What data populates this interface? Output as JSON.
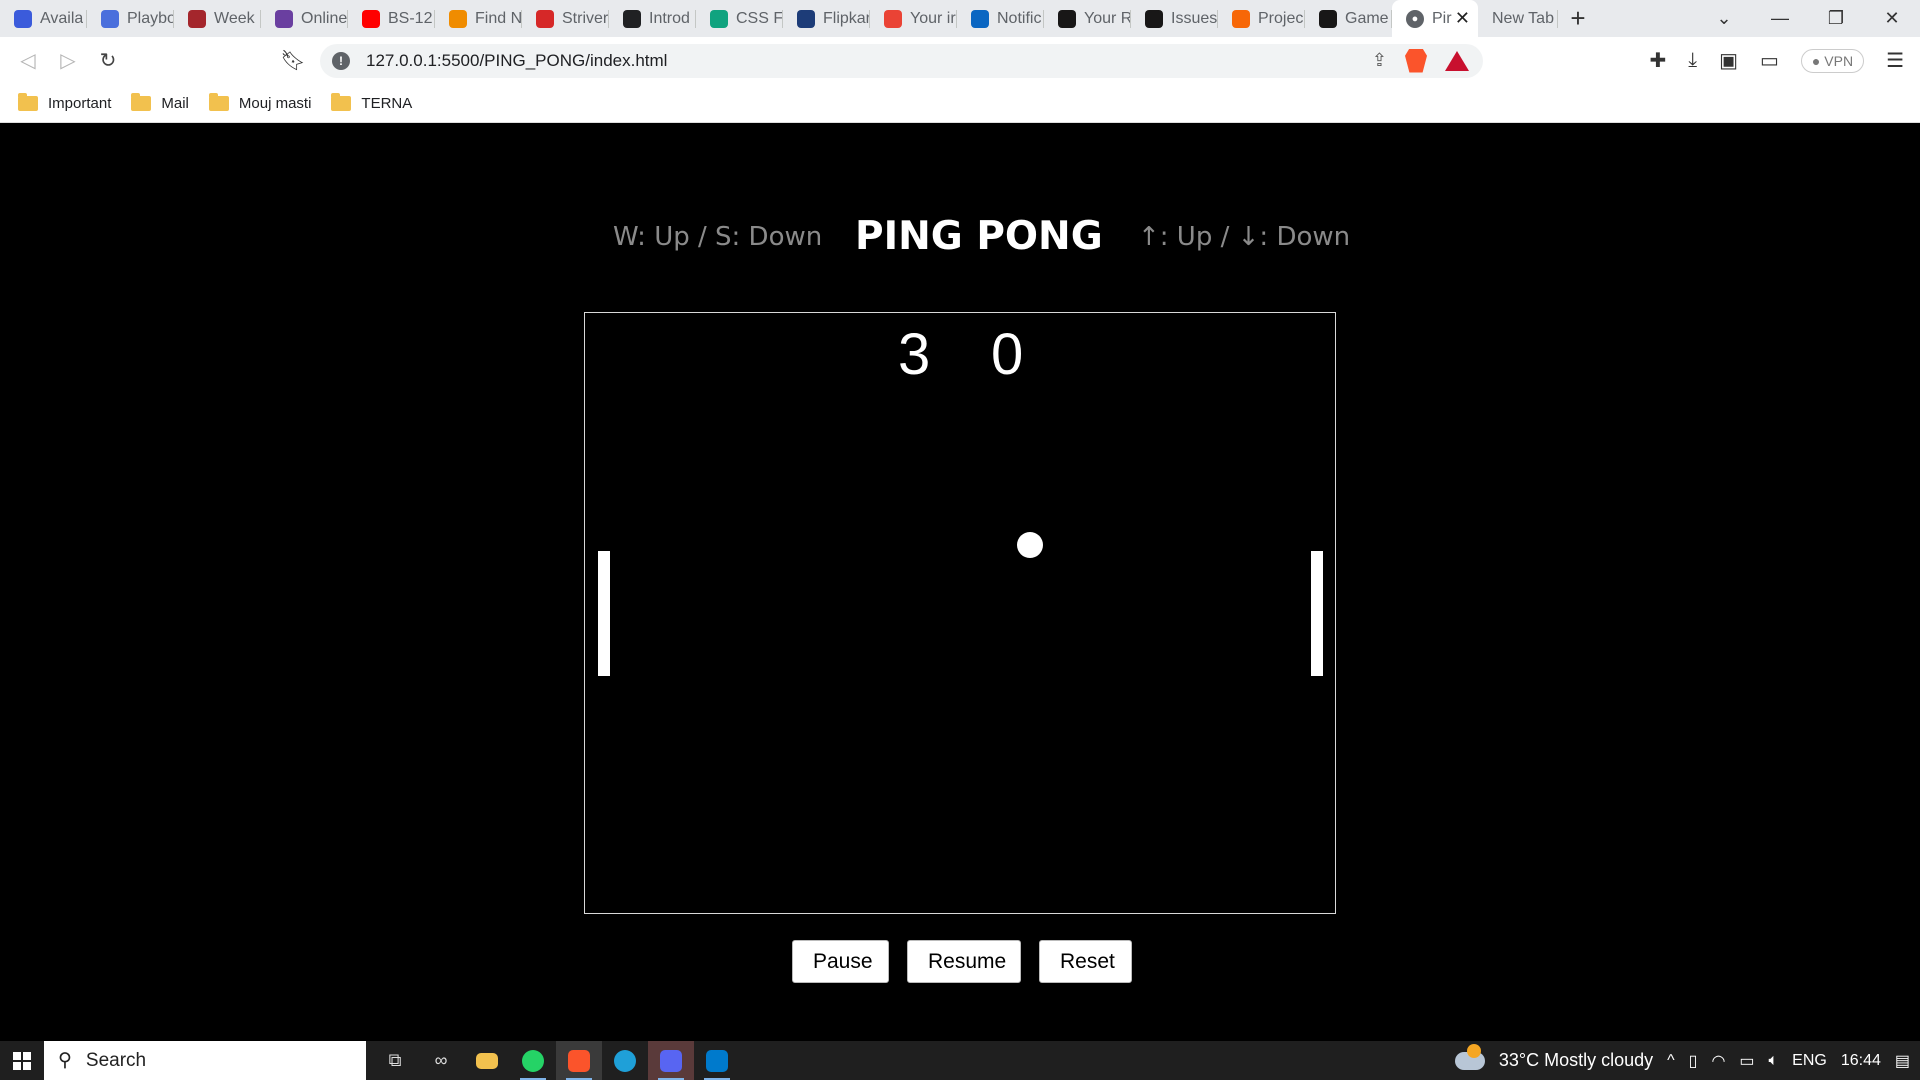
{
  "browser": {
    "tabs": [
      {
        "title": "Availa",
        "icon": "u-icon",
        "color": "#3b5bdb"
      },
      {
        "title": "Playbo",
        "icon": "ux-icon",
        "color": "#4a6fdc"
      },
      {
        "title": "Week",
        "icon": "shield-icon",
        "color": "#a4262c"
      },
      {
        "title": "Online",
        "icon": "bolt-icon",
        "color": "#6a3fa0"
      },
      {
        "title": "BS-12",
        "icon": "youtube-icon",
        "color": "#ff0000"
      },
      {
        "title": "Find N",
        "icon": "code-icon",
        "color": "#f08c00"
      },
      {
        "title": "Striver",
        "icon": "tuf-icon",
        "color": "#d62828"
      },
      {
        "title": "Introd",
        "icon": "openai-icon",
        "color": "#202123"
      },
      {
        "title": "CSS Fo",
        "icon": "openai-icon",
        "color": "#10a37f"
      },
      {
        "title": "Flipkar",
        "icon": "un-icon",
        "color": "#1d3c78"
      },
      {
        "title": "Your ir",
        "icon": "gmail-icon",
        "color": "#ea4335"
      },
      {
        "title": "Notific",
        "icon": "linkedin-icon",
        "color": "#0a66c2"
      },
      {
        "title": "Your R",
        "icon": "github-icon",
        "color": "#181717"
      },
      {
        "title": "Issues",
        "icon": "github-icon",
        "color": "#181717"
      },
      {
        "title": "Projec",
        "icon": "puzzle-icon",
        "color": "#f76707"
      },
      {
        "title": "Game",
        "icon": "github-icon",
        "color": "#181717"
      }
    ],
    "active_tab": {
      "title": "Pir",
      "icon": "globe-icon"
    },
    "new_tab": {
      "title": "New Tab"
    },
    "url": "127.0.0.1:5500/PING_PONG/index.html",
    "vpn_label": "VPN",
    "bookmarks": [
      "Important",
      "Mail",
      "Mouj masti",
      "TERNA"
    ]
  },
  "game": {
    "title": "PING PONG",
    "left_hint": "W: Up / S: Down",
    "right_hint": "↑: Up / ↓: Down",
    "score_left": "3",
    "score_right": "0",
    "buttons": {
      "pause": "Pause",
      "resume": "Resume",
      "reset": "Reset"
    }
  },
  "taskbar": {
    "search_placeholder": "Search",
    "weather": "33°C  Mostly cloudy",
    "language": "ENG",
    "time": "16:44"
  }
}
